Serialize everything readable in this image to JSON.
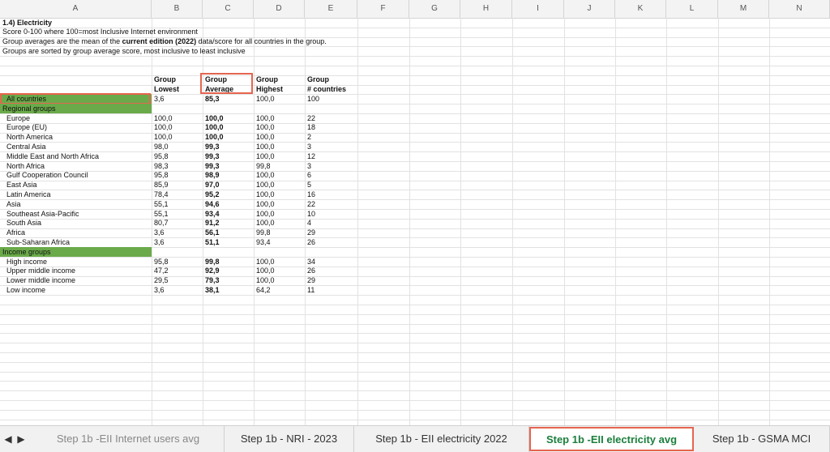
{
  "columns": [
    "A",
    "B",
    "C",
    "D",
    "E",
    "F",
    "G",
    "H",
    "I",
    "J",
    "K",
    "L",
    "M",
    "N"
  ],
  "title": "1.4) Electricity",
  "notes": [
    {
      "pre": "Score 0-100 where 100=most Inclusive Internet environment",
      "bold": "",
      "post": ""
    },
    {
      "pre": "Group averages are the mean of the ",
      "bold": "current edition (2022)",
      "post": "  data/score for all countries in the group."
    },
    {
      "pre": "Groups are sorted by group average score, most inclusive to least inclusive",
      "bold": "",
      "post": ""
    }
  ],
  "headers": {
    "lowest": [
      "Group",
      "Lowest"
    ],
    "average": [
      "Group",
      "Average"
    ],
    "highest": [
      "Group",
      "Highest"
    ],
    "count": [
      "Group",
      "# countries"
    ]
  },
  "all_countries": {
    "label": "All countries",
    "lowest": "3,6",
    "average": "85,3",
    "highest": "100,0",
    "count": "100"
  },
  "regional_label": "Regional groups",
  "regional": [
    {
      "label": "Europe",
      "lowest": "100,0",
      "average": "100,0",
      "highest": "100,0",
      "count": "22"
    },
    {
      "label": "Europe (EU)",
      "lowest": "100,0",
      "average": "100,0",
      "highest": "100,0",
      "count": "18"
    },
    {
      "label": "North America",
      "lowest": "100,0",
      "average": "100,0",
      "highest": "100,0",
      "count": "2"
    },
    {
      "label": "Central Asia",
      "lowest": "98,0",
      "average": "99,3",
      "highest": "100,0",
      "count": "3"
    },
    {
      "label": "Middle East and North Africa",
      "lowest": "95,8",
      "average": "99,3",
      "highest": "100,0",
      "count": "12"
    },
    {
      "label": "North Africa",
      "lowest": "98,3",
      "average": "99,3",
      "highest": "99,8",
      "count": "3"
    },
    {
      "label": "Gulf Cooperation Council",
      "lowest": "95,8",
      "average": "98,9",
      "highest": "100,0",
      "count": "6"
    },
    {
      "label": "East Asia",
      "lowest": "85,9",
      "average": "97,0",
      "highest": "100,0",
      "count": "5"
    },
    {
      "label": "Latin America",
      "lowest": "78,4",
      "average": "95,2",
      "highest": "100,0",
      "count": "16"
    },
    {
      "label": "Asia",
      "lowest": "55,1",
      "average": "94,6",
      "highest": "100,0",
      "count": "22"
    },
    {
      "label": "Southeast Asia-Pacific",
      "lowest": "55,1",
      "average": "93,4",
      "highest": "100,0",
      "count": "10"
    },
    {
      "label": "South Asia",
      "lowest": "80,7",
      "average": "91,2",
      "highest": "100,0",
      "count": "4"
    },
    {
      "label": "Africa",
      "lowest": "3,6",
      "average": "56,1",
      "highest": "99,8",
      "count": "29"
    },
    {
      "label": "Sub-Saharan Africa",
      "lowest": "3,6",
      "average": "51,1",
      "highest": "93,4",
      "count": "26"
    }
  ],
  "income_label": "Income groups",
  "income": [
    {
      "label": "High income",
      "lowest": "95,8",
      "average": "99,8",
      "highest": "100,0",
      "count": "34"
    },
    {
      "label": "Upper middle income",
      "lowest": "47,2",
      "average": "92,9",
      "highest": "100,0",
      "count": "26"
    },
    {
      "label": "Lower middle income",
      "lowest": "29,5",
      "average": "79,3",
      "highest": "100,0",
      "count": "29"
    },
    {
      "label": "Low income",
      "lowest": "3,6",
      "average": "38,1",
      "highest": "64,2",
      "count": "11"
    }
  ],
  "tabs": [
    {
      "label": "Step 1b -EII Internet users avg",
      "state": "faded"
    },
    {
      "label": "Step 1b - NRI - 2023",
      "state": "normal"
    },
    {
      "label": "Step 1b - EII electricity 2022",
      "state": "normal"
    },
    {
      "label": "Step 1b -EII electricity avg",
      "state": "active"
    },
    {
      "label": "Step 1b - GSMA MCI",
      "state": "normal"
    }
  ],
  "nav": {
    "prev_glyph": "◀",
    "next_glyph": "▶"
  },
  "colors": {
    "group_fill": "#6aaa4a",
    "highlight": "#e5654f",
    "active_tab_text": "#1a7f3c"
  }
}
